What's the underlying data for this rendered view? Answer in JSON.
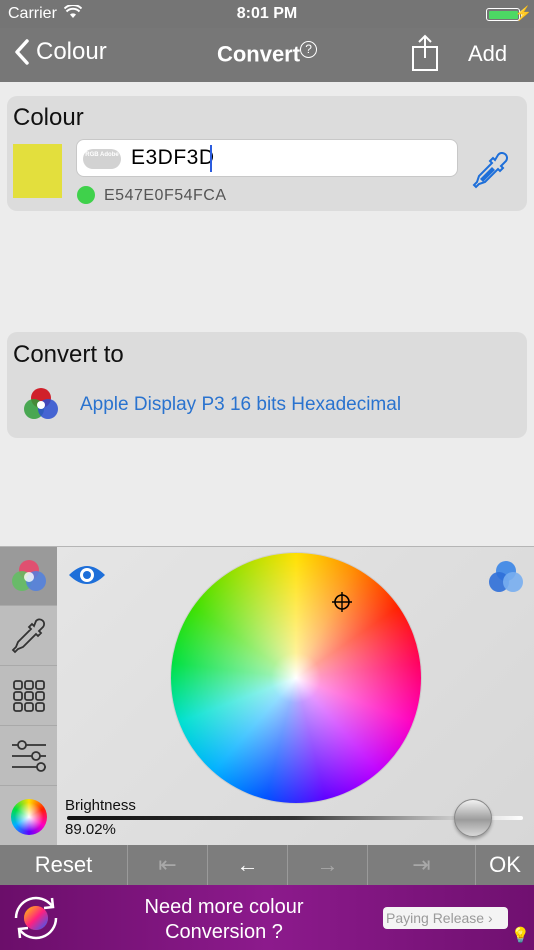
{
  "status_bar": {
    "carrier": "Carrier",
    "time": "8:01 PM"
  },
  "nav": {
    "back_label": "Colour",
    "title": "Convert",
    "help_glyph": "?",
    "add_label": "Add"
  },
  "colour_card": {
    "heading": "Colour",
    "swatch_color": "#E3DF3D",
    "badge_text": "RGB Adobe",
    "hex_value": "E3DF3D",
    "p3_value": "E547E0F54FCA",
    "status_color": "#3FD14B"
  },
  "convert_card": {
    "heading": "Convert to",
    "target": "Apple Display P3 16 bits Hexadecimal"
  },
  "picker": {
    "tabs": [
      "colour-mix-icon",
      "eyedropper-icon",
      "grid-icon",
      "sliders-icon",
      "colour-wheel-icon"
    ],
    "active_tab": 0,
    "brightness_label": "Brightness",
    "brightness_value": "89.02%",
    "brightness_fraction": 0.8902
  },
  "toolbar": {
    "reset": "Reset",
    "first": "⇤",
    "prev": "←",
    "next": "→",
    "last": "⇥",
    "ok": "OK"
  },
  "promo": {
    "line1": "Need more colour",
    "line2": "Conversion ?",
    "button": "Paying Release ›"
  }
}
